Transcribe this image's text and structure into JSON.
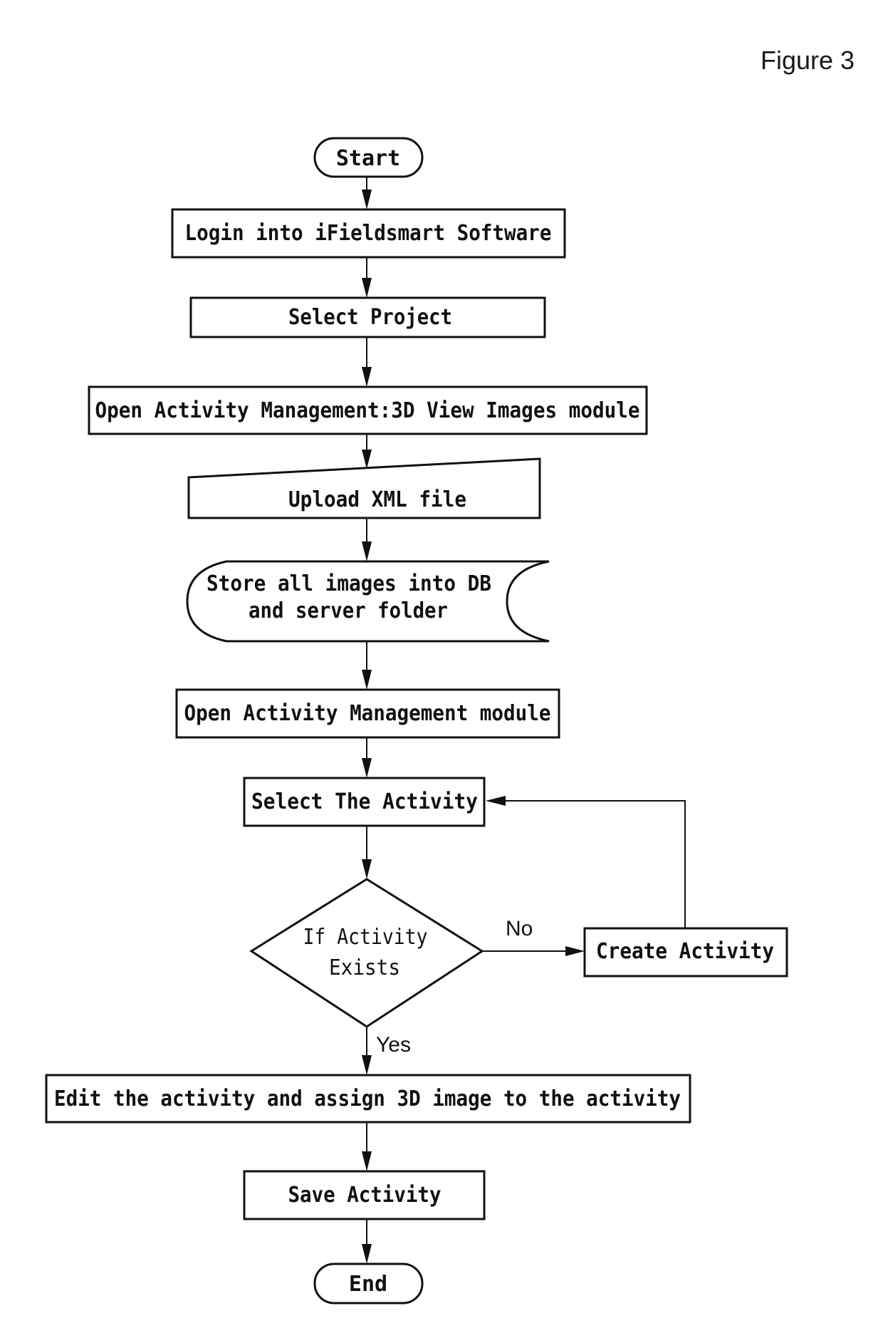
{
  "figure_label": "Figure 3",
  "nodes": {
    "start": {
      "type": "terminator",
      "label": "Start"
    },
    "login": {
      "type": "process",
      "label": "Login into iFieldsmart Software"
    },
    "select_project": {
      "type": "process",
      "label": "Select Project"
    },
    "open_3d_module": {
      "type": "process",
      "label": "Open Activity Management:3D View Images module"
    },
    "upload_xml": {
      "type": "manual-input",
      "label": "Upload XML file"
    },
    "store_images": {
      "type": "stored-data",
      "label_line1": "Store all images into DB",
      "label_line2": "and server folder"
    },
    "open_am_module": {
      "type": "process",
      "label": "Open Activity Management module"
    },
    "select_activity": {
      "type": "process",
      "label": "Select The Activity"
    },
    "decision": {
      "type": "decision",
      "label_line1": "If Activity",
      "label_line2": "Exists"
    },
    "create_activity": {
      "type": "process",
      "label": "Create Activity"
    },
    "edit_activity": {
      "type": "process",
      "label": "Edit the activity and assign 3D image to the activity"
    },
    "save_activity": {
      "type": "process",
      "label": "Save Activity"
    },
    "end": {
      "type": "terminator",
      "label": "End"
    }
  },
  "edges": [
    {
      "from": "start",
      "to": "login",
      "label": ""
    },
    {
      "from": "login",
      "to": "select_project",
      "label": ""
    },
    {
      "from": "select_project",
      "to": "open_3d_module",
      "label": ""
    },
    {
      "from": "open_3d_module",
      "to": "upload_xml",
      "label": ""
    },
    {
      "from": "upload_xml",
      "to": "store_images",
      "label": ""
    },
    {
      "from": "store_images",
      "to": "open_am_module",
      "label": ""
    },
    {
      "from": "open_am_module",
      "to": "select_activity",
      "label": ""
    },
    {
      "from": "select_activity",
      "to": "decision",
      "label": ""
    },
    {
      "from": "decision",
      "to": "create_activity",
      "label": "No"
    },
    {
      "from": "create_activity",
      "to": "select_activity",
      "label": ""
    },
    {
      "from": "decision",
      "to": "edit_activity",
      "label": "Yes"
    },
    {
      "from": "edit_activity",
      "to": "save_activity",
      "label": ""
    },
    {
      "from": "save_activity",
      "to": "end",
      "label": ""
    }
  ],
  "edge_labels": {
    "no": "No",
    "yes": "Yes"
  }
}
